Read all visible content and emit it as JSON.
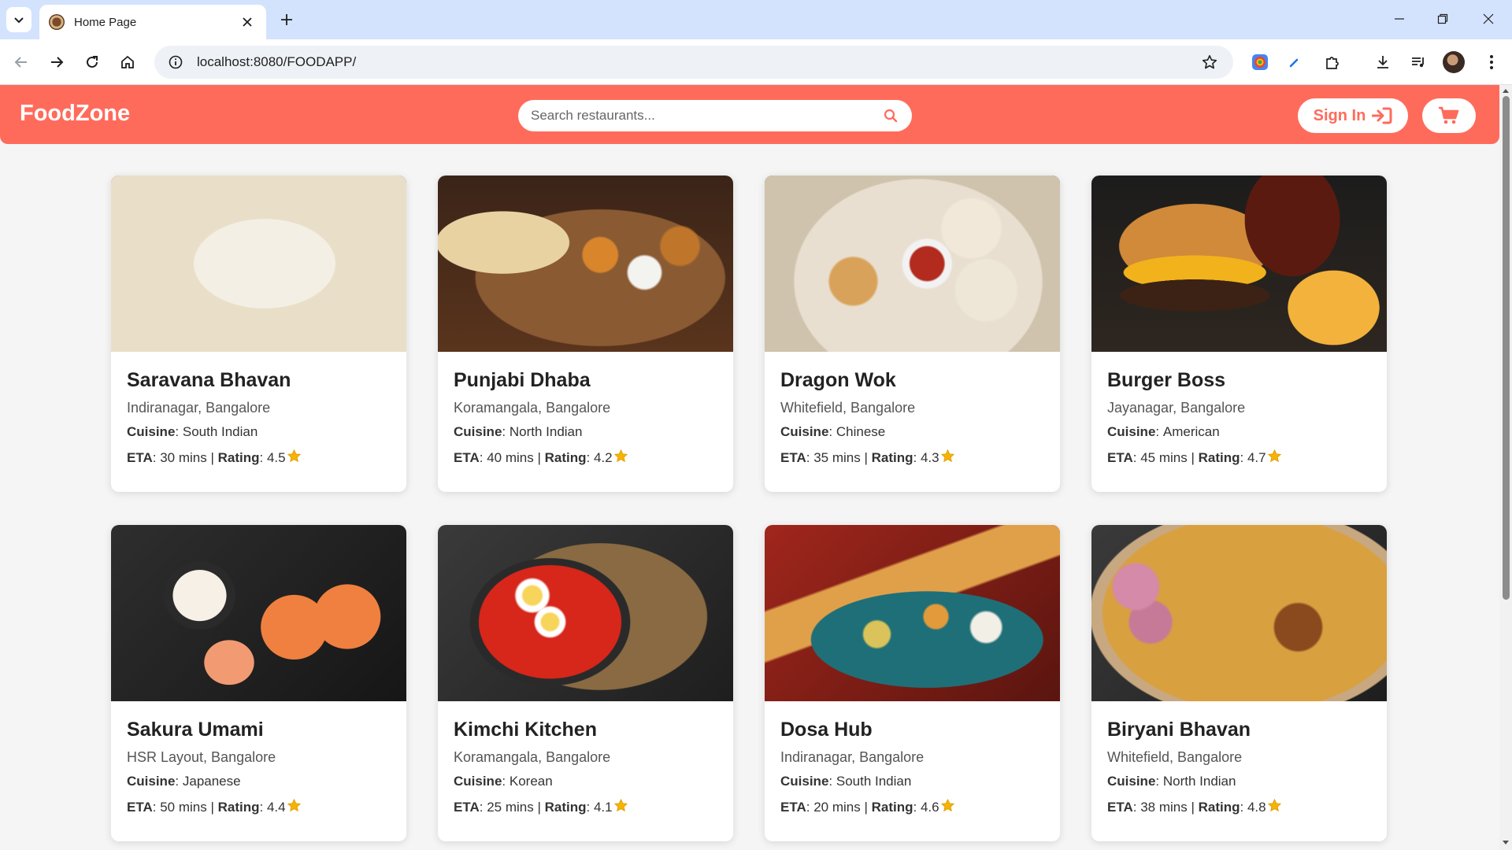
{
  "browser": {
    "tab_title": "Home Page",
    "url": "localhost:8080/FOODAPP/"
  },
  "header": {
    "brand": "FoodZone",
    "search_placeholder": "Search restaurants...",
    "signin_label": "Sign In",
    "accent_color": "#ff6b5b"
  },
  "labels": {
    "cuisine": "Cuisine",
    "eta": "ETA",
    "rating": "Rating",
    "separator": "|"
  },
  "restaurants": [
    {
      "name": "Saravana Bhavan",
      "location": "Indiranagar, Bangalore",
      "cuisine": "South Indian",
      "eta": "30 mins",
      "rating": "4.5"
    },
    {
      "name": "Punjabi Dhaba",
      "location": "Koramangala, Bangalore",
      "cuisine": "North Indian",
      "eta": "40 mins",
      "rating": "4.2"
    },
    {
      "name": "Dragon Wok",
      "location": "Whitefield, Bangalore",
      "cuisine": "Chinese",
      "eta": "35 mins",
      "rating": "4.3"
    },
    {
      "name": "Burger Boss",
      "location": "Jayanagar, Bangalore",
      "cuisine": "American",
      "eta": "45 mins",
      "rating": "4.7"
    },
    {
      "name": "Sakura Umami",
      "location": "HSR Layout, Bangalore",
      "cuisine": "Japanese",
      "eta": "50 mins",
      "rating": "4.4"
    },
    {
      "name": "Kimchi Kitchen",
      "location": "Koramangala, Bangalore",
      "cuisine": "Korean",
      "eta": "25 mins",
      "rating": "4.1"
    },
    {
      "name": "Dosa Hub",
      "location": "Indiranagar, Bangalore",
      "cuisine": "South Indian",
      "eta": "20 mins",
      "rating": "4.6"
    },
    {
      "name": "Biryani Bhavan",
      "location": "Whitefield, Bangalore",
      "cuisine": "North Indian",
      "eta": "38 mins",
      "rating": "4.8"
    }
  ]
}
